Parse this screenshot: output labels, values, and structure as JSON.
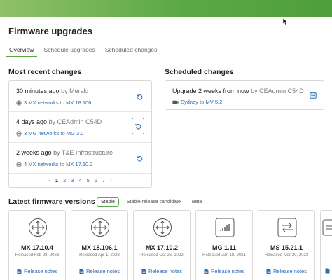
{
  "page": {
    "title": "Firmware upgrades"
  },
  "tabs": [
    {
      "label": "Overview",
      "active": true
    },
    {
      "label": "Schedule upgrades",
      "active": false
    },
    {
      "label": "Scheduled changes",
      "active": false
    }
  ],
  "recent": {
    "title": "Most recent changes",
    "items": [
      {
        "time": "30 minutes ago",
        "by": "by",
        "author": "Meraki",
        "networks": "3 MX networks",
        "to": "to",
        "version": "MX 18.106"
      },
      {
        "time": "4 days ago",
        "by": "by",
        "author": "CEAdmin C54D",
        "networks": "3 MG networks",
        "to": "to",
        "version": "MG 3.0"
      },
      {
        "time": "2 weeks ago",
        "by": "by",
        "author": "T&E Infrastructure",
        "networks": "4 MX networks",
        "to": "to",
        "version": "MX 17.10.2"
      }
    ],
    "pagination": {
      "prev": "‹",
      "pages": [
        "1",
        "2",
        "3",
        "4",
        "5",
        "6",
        "7"
      ],
      "current": "1",
      "next": "›"
    }
  },
  "scheduled": {
    "title": "Scheduled changes",
    "item": {
      "text": "Upgrade 2 weeks from now",
      "by": "by",
      "author": "CEAdmin C54D",
      "network": "Sydney",
      "to": "to",
      "version": "MV 5.2"
    }
  },
  "latest": {
    "title": "Latest firmware versions",
    "tabs": [
      {
        "label": "Stable",
        "active": true
      },
      {
        "label": "Stable release candidate",
        "active": false
      },
      {
        "label": "Beta",
        "active": false
      }
    ],
    "cards": [
      {
        "name": "MX 17.10.4",
        "released": "Released Feb 28, 2023",
        "notes": "Release notes",
        "icon": "router-icon"
      },
      {
        "name": "MX 18.106.1",
        "released": "Released Apr 1, 2023",
        "notes": "Release notes",
        "icon": "router-icon"
      },
      {
        "name": "MX 17.10.2",
        "released": "Released Oct 26, 2022",
        "notes": "Release notes",
        "icon": "router-icon"
      },
      {
        "name": "MG 1.11",
        "released": "Released Jun 18, 2021",
        "notes": "Release notes",
        "icon": "signal-bars-icon"
      },
      {
        "name": "MS 15.21.1",
        "released": "Released Mar 20, 2023",
        "notes": "Release notes",
        "icon": "switch-icon"
      }
    ]
  },
  "colors": {
    "brand_green": "#5aa845",
    "link_blue": "#2f6db3"
  }
}
